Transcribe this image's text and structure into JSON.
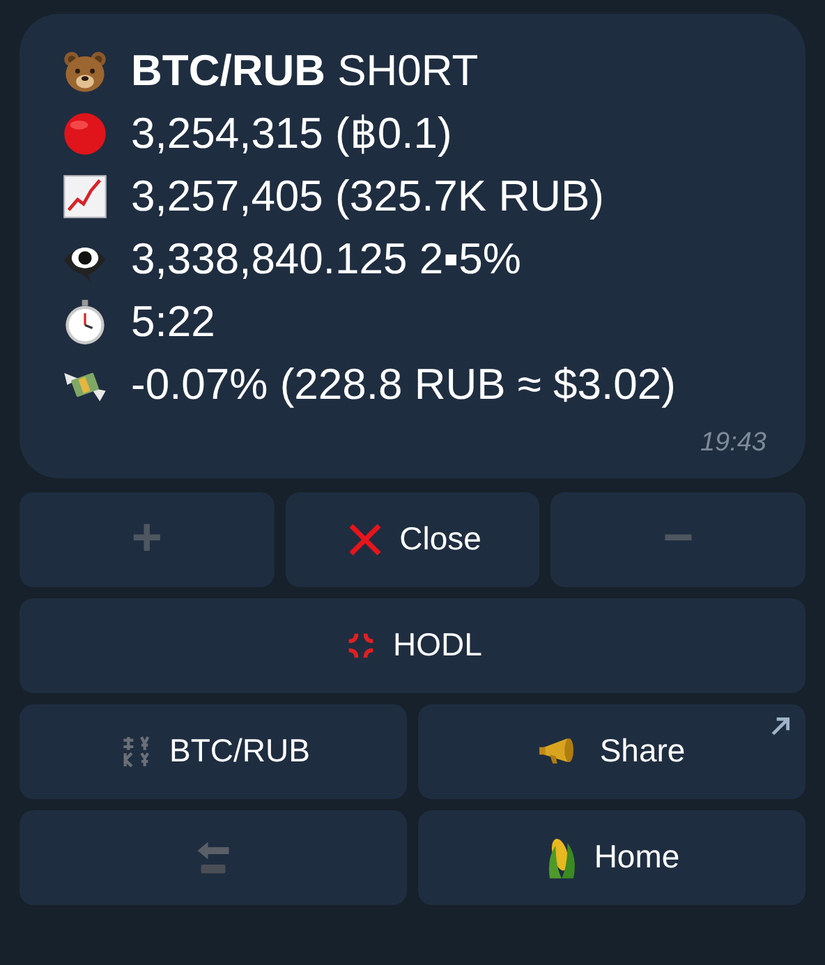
{
  "message": {
    "lines": [
      {
        "kind": "bear",
        "text": "**BTC/RUB** SH0RT"
      },
      {
        "kind": "circle",
        "text": "3,254,315 (฿0.1)"
      },
      {
        "kind": "chart",
        "text": "3,257,405 (325.7K RUB)"
      },
      {
        "kind": "eye",
        "text": "3,338,840.125 2▪5%"
      },
      {
        "kind": "stopwatch",
        "text": "5:22"
      },
      {
        "kind": "money",
        "text": "-0.07% (228.8 RUB ≈ $3.02)"
      }
    ],
    "time": "19:43"
  },
  "keyboard": [
    [
      {
        "label": "+",
        "kind": "symbol",
        "link": false
      },
      {
        "label": "Close",
        "kind": "cross",
        "link": false
      },
      {
        "label": "−",
        "kind": "symbol",
        "link": false
      }
    ],
    [
      {
        "label": "HODL",
        "kind": "anger",
        "link": false
      }
    ],
    [
      {
        "label": "BTC/RUB",
        "kind": "exchange",
        "link": false
      },
      {
        "label": "Share",
        "kind": "megaphone",
        "link": true
      }
    ],
    [
      {
        "kind": "back",
        "link": false
      },
      {
        "label": "Home",
        "kind": "corn",
        "link": false
      }
    ]
  ]
}
